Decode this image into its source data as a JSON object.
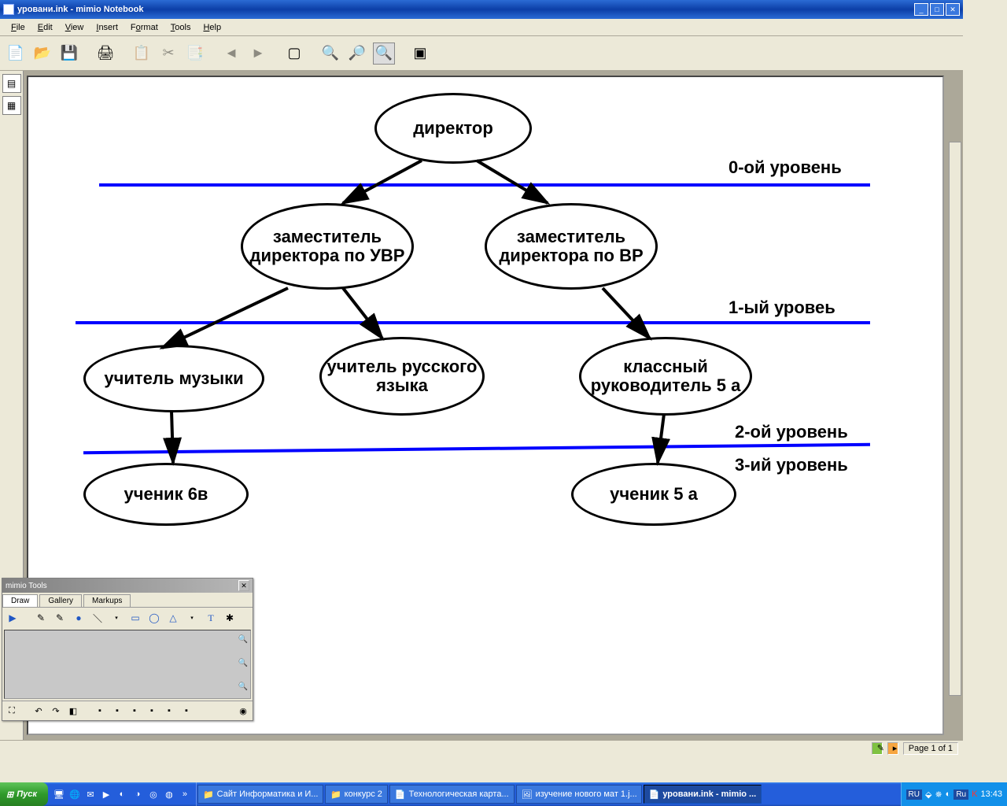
{
  "window": {
    "title": "уровани.ink - mimio Notebook"
  },
  "menu": {
    "file": "File",
    "edit": "Edit",
    "view": "View",
    "insert": "Insert",
    "format": "Format",
    "tools": "Tools",
    "help": "Help"
  },
  "diagram": {
    "nodes": {
      "director": "директор",
      "deputy_uvr": "заместитель директора по УВР",
      "deputy_vr": "заместитель директора по ВР",
      "music": "учитель музыки",
      "russian": "учитель русского языка",
      "classroom": "классный руководитель 5 a",
      "student6v": "ученик 6в",
      "student5a": "ученик 5 a"
    },
    "levels": {
      "l0": "0-ой уровень",
      "l1": "1-ый уровеь",
      "l2": "2-ой уровень",
      "l3": "3-ий уровень"
    }
  },
  "mimio": {
    "title": "mimio Tools",
    "tabs": {
      "draw": "Draw",
      "gallery": "Gallery",
      "markups": "Markups"
    }
  },
  "status": {
    "page": "Page 1 of 1"
  },
  "taskbar": {
    "start": "Пуск",
    "tasks": {
      "t1": "Сайт Информатика и И...",
      "t2": "конкурс 2",
      "t3": "Технологическая карта...",
      "t4": "изучение нового мат 1.j...",
      "t5": "уровани.ink - mimio ..."
    },
    "lang1": "RU",
    "lang2": "Ru",
    "clock": "13:43"
  }
}
